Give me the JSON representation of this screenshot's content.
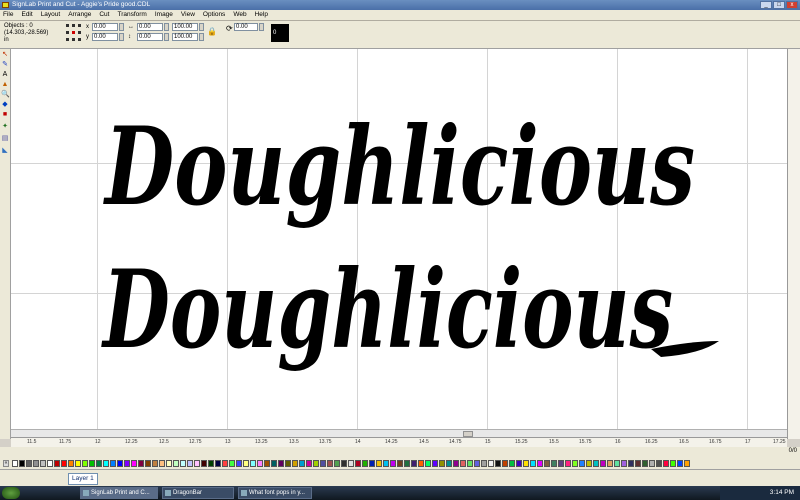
{
  "window": {
    "title": "SignLab Print and Cut - Aggie's Pride good.CDL",
    "controls": [
      "_",
      "□",
      "x"
    ]
  },
  "menu": [
    "File",
    "Edit",
    "Layout",
    "Arrange",
    "Cut",
    "Transform",
    "Image",
    "View",
    "Options",
    "Web",
    "Help"
  ],
  "property_bar": {
    "objects_label": "Objects : 0",
    "coords": "(14.303,-28.569)",
    "units": "in",
    "x_label": "x",
    "x_value": "0.00",
    "y_label": "y",
    "y_value": "0.00",
    "w_value": "0.00",
    "h_value": "0.00",
    "scale_w": "100.00",
    "scale_h": "100.00",
    "rotate_value": "0.00",
    "mirror_label": "0"
  },
  "canvas": {
    "text_top": "Doughlicious",
    "text_bottom": "Doughlicious"
  },
  "ruler_h_ticks": [
    "11.5",
    "11.75",
    "12",
    "12.25",
    "12.5",
    "12.75",
    "13",
    "13.25",
    "13.5",
    "13.75",
    "14",
    "14.25",
    "14.5",
    "14.75",
    "15",
    "15.25",
    "15.5",
    "15.75",
    "16",
    "16.25",
    "16.5",
    "16.75",
    "17",
    "17.25"
  ],
  "page_nav": "0/0",
  "palette_colors": [
    "#ffffff",
    "#000000",
    "#606060",
    "#909090",
    "#c0c0c0",
    "#ffffff",
    "#c00000",
    "#ff0000",
    "#ff8000",
    "#ffff00",
    "#80ff00",
    "#00c000",
    "#008040",
    "#00ffff",
    "#0080ff",
    "#0000ff",
    "#8000ff",
    "#ff00ff",
    "#800040",
    "#804000",
    "#c08040",
    "#ffc080",
    "#ffffc0",
    "#c0ffc0",
    "#c0ffff",
    "#c0c0ff",
    "#ffc0ff",
    "#400000",
    "#004000",
    "#000040",
    "#ff4040",
    "#40ff40",
    "#4040ff",
    "#ffff80",
    "#80ffff",
    "#ff80ff",
    "#a05000",
    "#006060",
    "#600060",
    "#606000",
    "#d0a000",
    "#00a0d0",
    "#d000a0",
    "#a0d000",
    "#5050a0",
    "#a05050",
    "#50a050",
    "#303030",
    "#e0e0e0",
    "#b00020",
    "#20b000",
    "#0020b0",
    "#f0c000",
    "#00c0f0",
    "#c000f0",
    "#704020",
    "#207040",
    "#402070",
    "#ff6000",
    "#00ff60",
    "#6000ff",
    "#909000",
    "#009090",
    "#900090",
    "#e06060",
    "#60e060",
    "#6060e0",
    "#a0a0a0",
    "#f0f0f0",
    "#101010",
    "#c04000",
    "#00c040",
    "#4000c0",
    "#ffe000",
    "#00e0ff",
    "#e000ff",
    "#806040",
    "#408060",
    "#604080",
    "#ff2080",
    "#80ff20",
    "#2080ff",
    "#c0c000",
    "#00c0c0",
    "#c000c0",
    "#e0a060",
    "#60e0a0",
    "#a060e0",
    "#303060",
    "#603030",
    "#306030",
    "#b0b0b0",
    "#505050",
    "#ff0040",
    "#40ff00",
    "#0040ff",
    "#ffa000"
  ],
  "layer_tab": "Layer 1",
  "taskbar": {
    "tasks": [
      "SignLab Print and C...",
      "DragonBar",
      "What font pops in y..."
    ],
    "clock": "3:14 PM"
  }
}
